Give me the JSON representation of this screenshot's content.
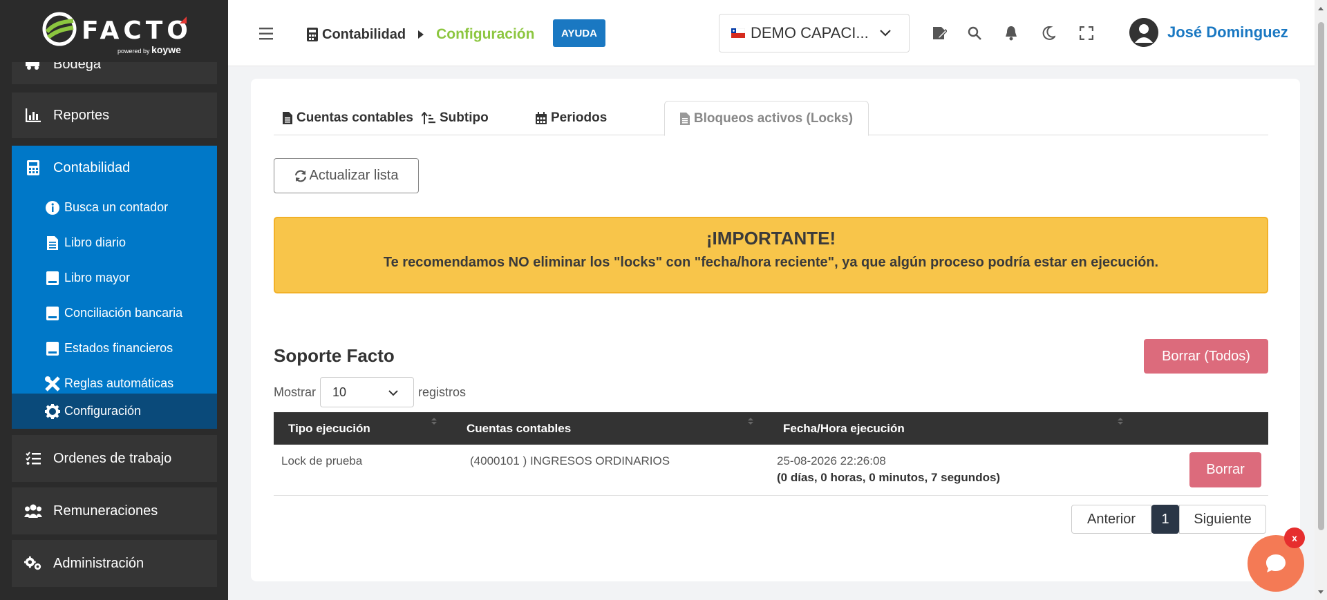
{
  "brand": {
    "name": "FACTO",
    "powered": "powered",
    "by": "by",
    "partner": "koywe"
  },
  "sidebar": {
    "items_top": [
      {
        "label": "Bodega",
        "icon": "truck-icon"
      },
      {
        "label": "Reportes",
        "icon": "chart-icon"
      }
    ],
    "group": {
      "label": "Contabilidad",
      "icon": "calculator-icon",
      "items": [
        {
          "label": "Busca un contador",
          "icon": "info-icon"
        },
        {
          "label": "Libro diario",
          "icon": "file-icon"
        },
        {
          "label": "Libro mayor",
          "icon": "book-icon"
        },
        {
          "label": "Conciliación bancaria",
          "icon": "book-icon"
        },
        {
          "label": "Estados financieros",
          "icon": "book-icon"
        },
        {
          "label": "Reglas automáticas",
          "icon": "tools-icon"
        },
        {
          "label": "Configuración",
          "icon": "gear-icon",
          "active": true
        }
      ]
    },
    "items_bottom": [
      {
        "label": "Ordenes de trabajo",
        "icon": "tasks-icon"
      },
      {
        "label": "Remuneraciones",
        "icon": "users-icon"
      },
      {
        "label": "Administración",
        "icon": "gears-icon"
      }
    ]
  },
  "header": {
    "breadcrumb_parent": "Contabilidad",
    "breadcrumb_current": "Configuración",
    "help": "AYUDA",
    "company": "DEMO CAPACI...",
    "user": "José Dominguez"
  },
  "colors": {
    "accent": "#0078c8",
    "brand_green": "#8cc63f",
    "danger": "#dc6b7c",
    "warning": "#f8c54a"
  },
  "tabs": [
    {
      "label": "Cuentas contables",
      "icon": "file-icon"
    },
    {
      "label": "Subtipo",
      "icon": "sort-icon"
    },
    {
      "label": "Periodos",
      "icon": "calendar-icon"
    },
    {
      "label": "Bloqueos activos (Locks)",
      "icon": "file-icon",
      "active": true
    }
  ],
  "refresh_label": "Actualizar lista",
  "alert": {
    "title": "¡IMPORTANTE!",
    "text": "Te recomendamos NO eliminar los \"locks\" con \"fecha/hora reciente\", ya que algún proceso podría estar en ejecución."
  },
  "section": {
    "title": "Soporte Facto",
    "delete_all": "Borrar (Todos)"
  },
  "length": {
    "prefix": "Mostrar",
    "value": "10",
    "suffix": "registros"
  },
  "table": {
    "columns": [
      "Tipo ejecución",
      "Cuentas contables",
      "Fecha/Hora ejecución",
      ""
    ],
    "rows": [
      {
        "tipo": "Lock de prueba",
        "cuentas": "(4000101 ) INGRESOS ORDINARIOS",
        "fecha": "25-08-2026 22:26:08",
        "elapsed": "(0 días, 0 horas, 0 minutos, 7 segundos)",
        "action": "Borrar"
      }
    ]
  },
  "pagination": {
    "prev": "Anterior",
    "page": "1",
    "next": "Siguiente"
  },
  "chat": {
    "close": "x"
  }
}
